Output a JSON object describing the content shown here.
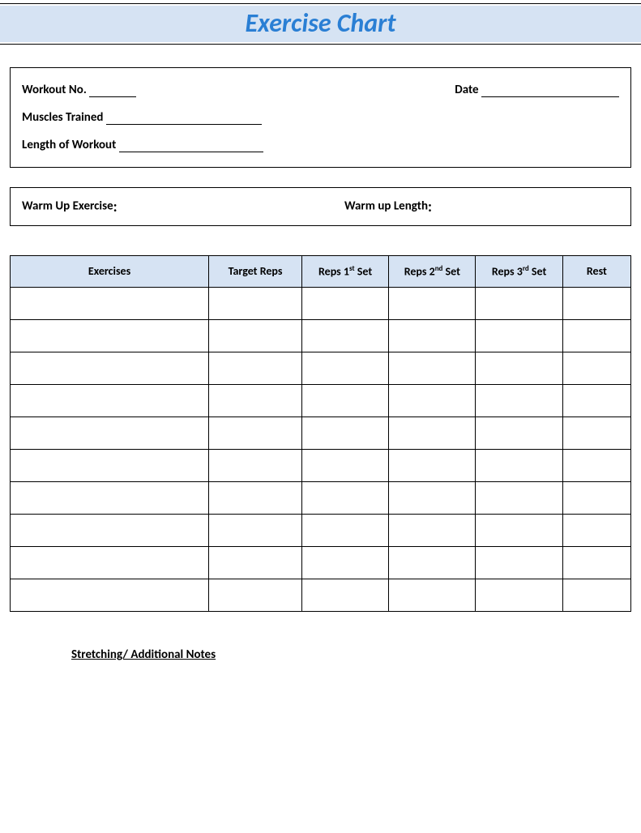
{
  "title": "Exercise Chart",
  "info": {
    "workout_no_label": "Workout No.",
    "date_label": "Date",
    "muscles_trained_label": "Muscles Trained",
    "length_of_workout_label": "Length of Workout"
  },
  "warmup": {
    "exercise_label": "Warm Up Exercise",
    "length_label": "Warm up Length"
  },
  "table": {
    "headers": {
      "exercises": "Exercises",
      "target_reps": "Target Reps",
      "reps1_prefix": "Reps 1",
      "reps1_sup": "st",
      "reps1_suffix": " Set",
      "reps2_prefix": "Reps 2",
      "reps2_sup": "nd",
      "reps2_suffix": " Set",
      "reps3_prefix": "Reps 3",
      "reps3_sup": "rd",
      "reps3_suffix": " Set",
      "rest": "Rest"
    },
    "row_count": 10
  },
  "notes_label": "Stretching/ Additional Notes"
}
